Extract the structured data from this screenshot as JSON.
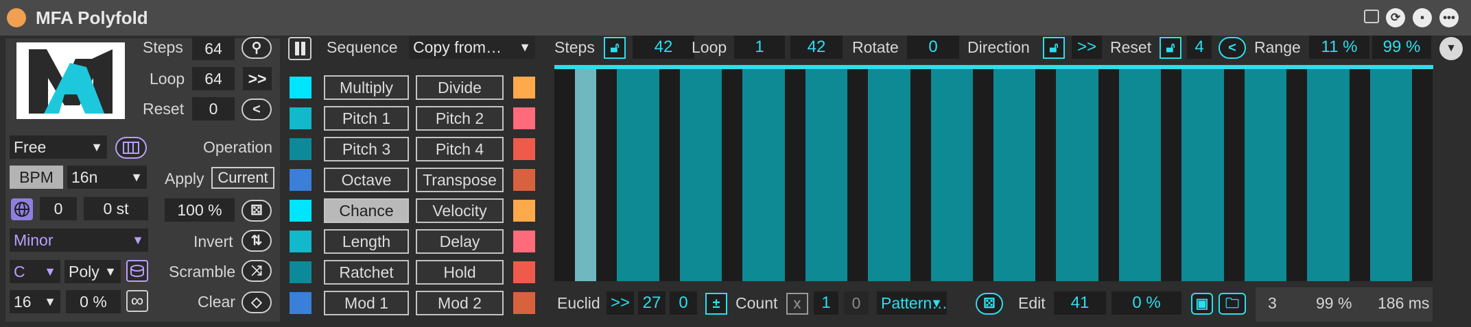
{
  "window": {
    "title": "MFA Polyfold",
    "header_icons": [
      "screen-icon",
      "refresh-icon",
      "save-icon",
      "more-icon"
    ]
  },
  "left": {
    "steps_label": "Steps",
    "steps_value": "64",
    "loop_label": "Loop",
    "loop_value": "64",
    "loop_btn": ">>",
    "reset_label": "Reset",
    "reset_value": "0",
    "reset_btn": "<",
    "mode": "Free",
    "bpm_label": "BPM",
    "rate": "16n",
    "transpose_oct": "0",
    "transpose_st": "0 st",
    "scale": "Minor",
    "key": "C",
    "voice": "Poly",
    "length": "16",
    "swing": "0 %"
  },
  "ops": {
    "sequence_label": "Sequence",
    "copy_from": "Copy from…",
    "operation_label": "Operation",
    "apply_label": "Apply",
    "apply_value": "Current",
    "amount": "100 %",
    "invert_label": "Invert",
    "scramble_label": "Scramble",
    "clear_label": "Clear",
    "left_ops": [
      "Multiply",
      "Pitch 1",
      "Pitch 3",
      "Octave",
      "Chance",
      "Length",
      "Ratchet",
      "Mod 1"
    ],
    "right_ops": [
      "Divide",
      "Pitch 2",
      "Pitch 4",
      "Transpose",
      "Velocity",
      "Delay",
      "Hold",
      "Mod 2"
    ],
    "left_colors": [
      "#00e5ff",
      "#12b8cc",
      "#0d8a99",
      "#3a7fd8",
      "#00e5ff",
      "#12b8cc",
      "#0d8a99",
      "#3a7fd8"
    ],
    "right_colors": [
      "#ffa94d",
      "#ff6b7a",
      "#f05a4a",
      "#d8623e",
      "#ffa94d",
      "#ff6b7a",
      "#f05a4a",
      "#d8623e"
    ],
    "active_op": "Chance"
  },
  "grid_header": {
    "steps_label": "Steps",
    "steps_value": "42",
    "loop_label": "Loop",
    "loop_start": "1",
    "loop_end": "42",
    "rotate_label": "Rotate",
    "rotate_value": "0",
    "direction_label": "Direction",
    "direction_value": ">>",
    "reset_label": "Reset",
    "reset_value": "4",
    "reset_btn": "<",
    "range_label": "Range",
    "range_low": "11 %",
    "range_high": "99 %"
  },
  "grid": {
    "num_steps": 42,
    "active_steps": [
      2,
      4,
      5,
      7,
      8,
      10,
      11,
      13,
      14,
      16,
      17,
      19,
      20,
      22,
      23,
      25,
      26,
      28,
      29,
      31,
      32,
      34,
      35,
      37,
      38,
      40,
      41
    ],
    "highlight_step": 2,
    "bar_color": "#0e8a94",
    "highlight_color": "#6fb8c0",
    "cap_color": "#2cdfef"
  },
  "footer": {
    "euclid_label": "Euclid",
    "euclid_btn": ">>",
    "euclid_hits": "27",
    "euclid_rot": "0",
    "pm_btn": "±",
    "count_label": "Count",
    "count_x": "x",
    "count_a": "1",
    "count_b": "0",
    "pattern": "Pattern…",
    "edit_label": "Edit",
    "edit_value": "41",
    "edit_pct": "0 %",
    "stat_count": "3",
    "stat_pct": "99 %",
    "stat_ms": "186 ms"
  },
  "colors": {
    "accent": "#2cdfef",
    "purple": "#b9a0ff",
    "title_dot": "#f0a050"
  }
}
